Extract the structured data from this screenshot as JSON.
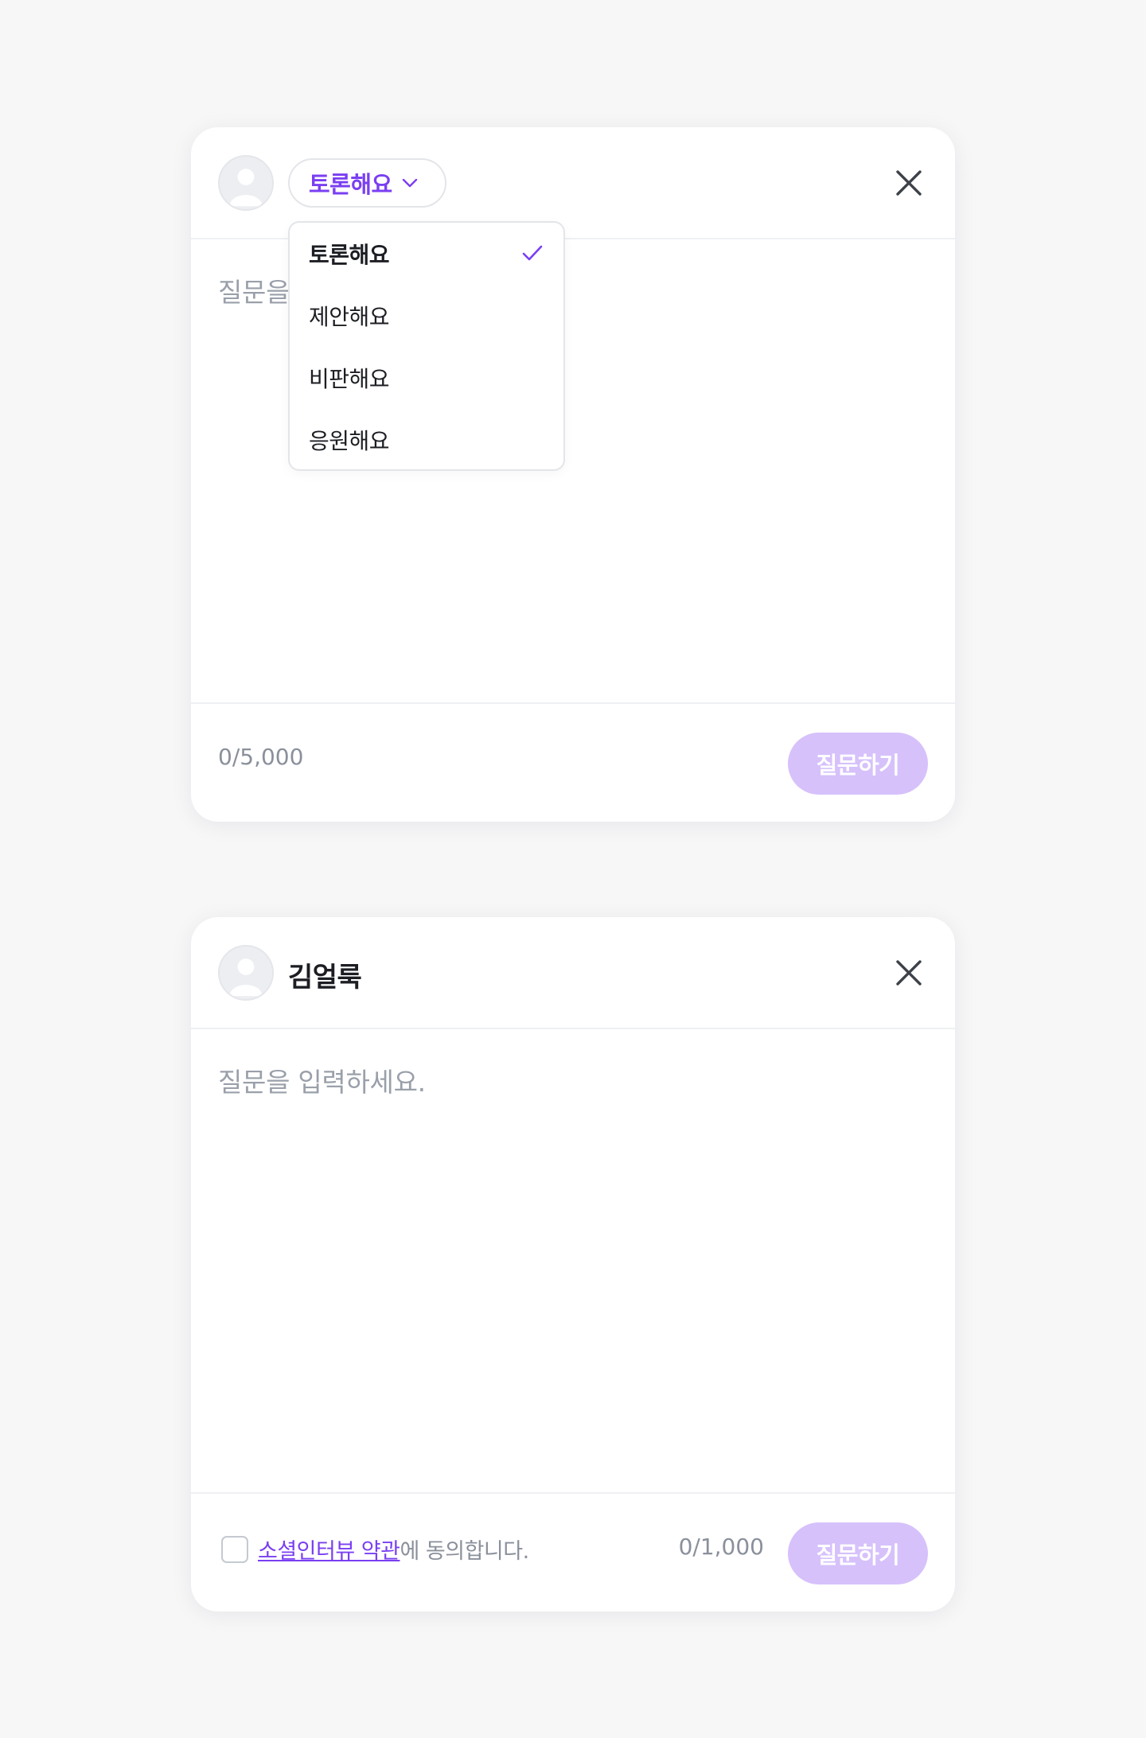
{
  "colors": {
    "accent": "#7a3ff2",
    "button_disabled": "#d6c1fb",
    "placeholder": "#9aa0aa"
  },
  "form1": {
    "topic_selected": "토론해요",
    "dropdown_options": [
      "토론해요",
      "제안해요",
      "비판해요",
      "응원해요"
    ],
    "placeholder": "질문을 입력하세요.",
    "counter": "0/5,000",
    "submit_label": "질문하기"
  },
  "form2": {
    "username": "김얼룩",
    "placeholder": "질문을 입력하세요.",
    "terms_link": "소셜인터뷰 약관",
    "terms_suffix": "에 동의합니다.",
    "counter": "0/1,000",
    "submit_label": "질문하기"
  },
  "icons": {
    "avatar": "user-avatar-icon",
    "close": "close-icon",
    "chevron": "chevron-down-icon",
    "check": "check-icon"
  }
}
